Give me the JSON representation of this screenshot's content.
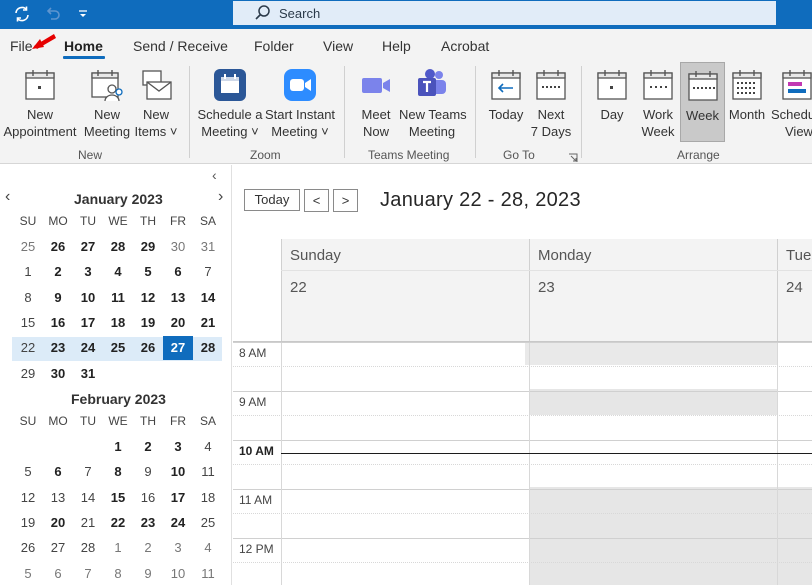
{
  "search": {
    "placeholder": "Search"
  },
  "tabs": [
    {
      "label": "File"
    },
    {
      "label": "Home"
    },
    {
      "label": "Send / Receive"
    },
    {
      "label": "Folder"
    },
    {
      "label": "View"
    },
    {
      "label": "Help"
    },
    {
      "label": "Acrobat"
    }
  ],
  "ribbon": {
    "buttons": {
      "new_appointment": [
        "New",
        "Appointment"
      ],
      "new_meeting": [
        "New",
        "Meeting"
      ],
      "new_items": [
        "New",
        "Items ˅"
      ],
      "schedule_meeting": [
        "Schedule a",
        "Meeting ˅"
      ],
      "start_instant": [
        "Start Instant",
        "Meeting ˅"
      ],
      "meet_now": [
        "Meet",
        "Now"
      ],
      "new_teams": [
        "New Teams",
        "Meeting"
      ],
      "today": [
        "Today"
      ],
      "next7": [
        "Next",
        "7 Days"
      ],
      "day": [
        "Day"
      ],
      "work_week": [
        "Work",
        "Week"
      ],
      "week": [
        "Week"
      ],
      "month": [
        "Month"
      ],
      "schedule_view": [
        "Schedule",
        "View"
      ]
    },
    "groups": {
      "new": "New",
      "zoom": "Zoom",
      "teams": "Teams Meeting",
      "goto": "Go To",
      "arrange": "Arrange"
    }
  },
  "mini_calendar": {
    "dow": [
      "SU",
      "MO",
      "TU",
      "WE",
      "TH",
      "FR",
      "SA"
    ],
    "jan_title": "January 2023",
    "feb_title": "February 2023",
    "jan_weeks": [
      [
        "25",
        "26",
        "27",
        "28",
        "29",
        "30",
        "31"
      ],
      [
        "1",
        "2",
        "3",
        "4",
        "5",
        "6",
        "7"
      ],
      [
        "8",
        "9",
        "10",
        "11",
        "12",
        "13",
        "14"
      ],
      [
        "15",
        "16",
        "17",
        "18",
        "19",
        "20",
        "21"
      ],
      [
        "22",
        "23",
        "24",
        "25",
        "26",
        "27",
        "28"
      ],
      [
        "29",
        "30",
        "31",
        "",
        "",
        "",
        ""
      ]
    ],
    "feb_weeks": [
      [
        "",
        "",
        "",
        "1",
        "2",
        "3",
        "4"
      ],
      [
        "5",
        "6",
        "7",
        "8",
        "9",
        "10",
        "11"
      ],
      [
        "12",
        "13",
        "14",
        "15",
        "16",
        "17",
        "18"
      ],
      [
        "19",
        "20",
        "21",
        "22",
        "23",
        "24",
        "25"
      ],
      [
        "26",
        "27",
        "28",
        "1",
        "2",
        "3",
        "4"
      ],
      [
        "5",
        "6",
        "7",
        "8",
        "9",
        "10",
        "11"
      ]
    ]
  },
  "main": {
    "today_button": "Today",
    "prev": "<",
    "next": ">",
    "range_title": "January 22 - 28, 2023",
    "days": [
      {
        "name": "Sunday",
        "num": "22"
      },
      {
        "name": "Monday",
        "num": "23"
      },
      {
        "name": "Tue",
        "num": "24"
      }
    ],
    "times": [
      "8 AM",
      "9 AM",
      "10 AM",
      "11 AM",
      "12 PM"
    ]
  }
}
